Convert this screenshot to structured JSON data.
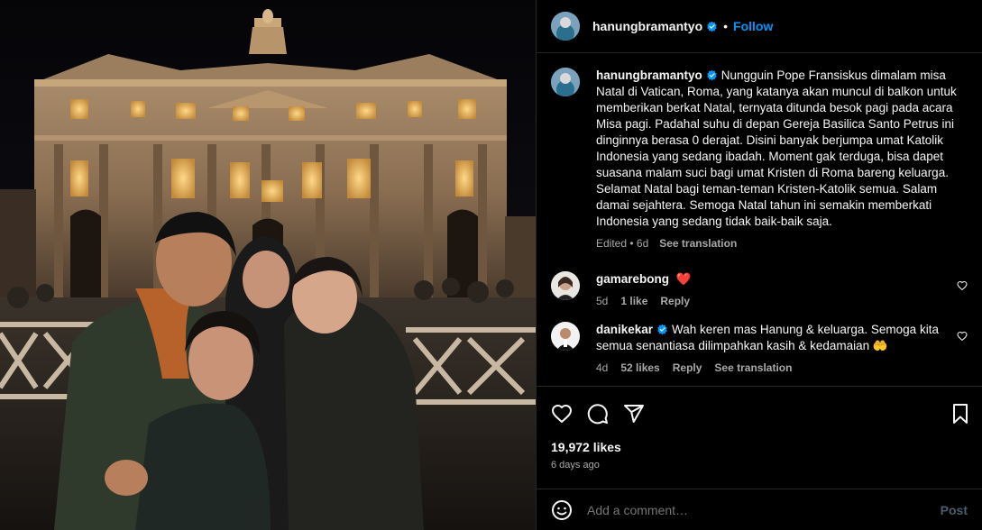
{
  "header": {
    "username": "hanungbramantyo",
    "dot": "•",
    "follow_label": "Follow"
  },
  "caption": {
    "username": "hanungbramantyo",
    "text": "Nungguin Pope Fransiskus dimalam misa Natal di Vatican, Roma, yang katanya akan muncul di balkon untuk memberikan berkat Natal, ternyata ditunda besok pagi pada acara Misa pagi. Padahal suhu di depan Gereja Basilica Santo Petrus ini dinginnya berasa 0 derajat. Disini banyak berjumpa umat Katolik Indonesia yang sedang ibadah. Moment gak terduga, bisa dapet suasana malam suci bagi umat Kristen di Roma bareng keluarga. Selamat Natal bagi teman-teman Kristen-Katolik semua. Salam damai sejahtera. Semoga Natal tahun ini semakin memberkati Indonesia yang sedang tidak baik-baik saja.",
    "meta_time": "Edited • 6d",
    "see_translation": "See translation"
  },
  "comments": [
    {
      "username": "gamarebong",
      "text": "❤️",
      "time": "5d",
      "likes": "1 like",
      "reply": "Reply"
    },
    {
      "username": "danikekar",
      "text": "Wah keren mas Hanung & keluarga. Semoga kita semua senantiasa dilimpahkan kasih & kedamaian 🤲",
      "time": "4d",
      "likes": "52 likes",
      "reply": "Reply",
      "see_translation": "See translation"
    }
  ],
  "stats": {
    "likes": "19,972 likes",
    "date": "6 days ago"
  },
  "composer": {
    "placeholder": "Add a comment…",
    "post_label": "Post"
  },
  "icons": {
    "like": "heart-icon",
    "comment": "comment-icon",
    "share": "share-icon",
    "save": "bookmark-icon",
    "emoji": "emoji-icon",
    "verified": "verified-badge-icon"
  },
  "colors": {
    "background": "#000000",
    "text": "#f5f5f5",
    "secondary": "#a8a8a8",
    "accent": "#0095f6",
    "border": "#262626",
    "verified": "#0095f6"
  }
}
